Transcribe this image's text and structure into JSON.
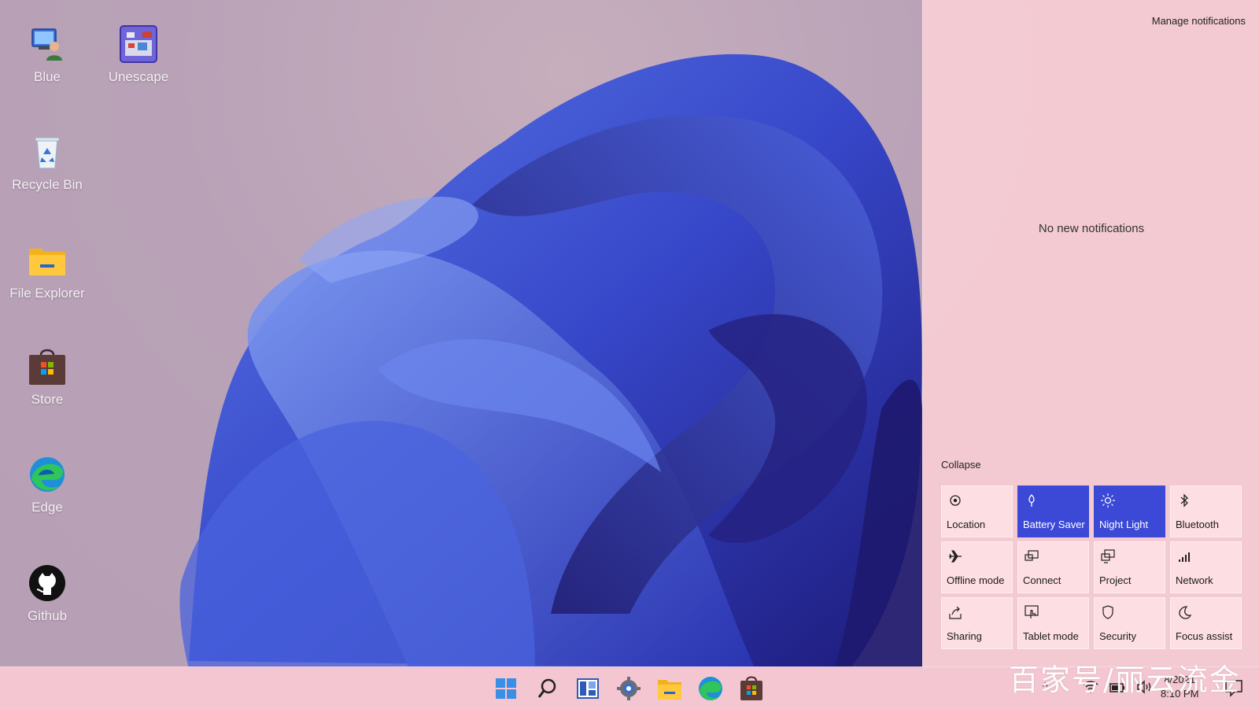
{
  "desktop": {
    "icons": [
      {
        "label": "Blue",
        "icon": "user-computer-icon"
      },
      {
        "label": "Unescape",
        "icon": "unescape-game-icon"
      },
      {
        "label": "Recycle Bin",
        "icon": "recycle-bin-icon"
      },
      {
        "label": "File Explorer",
        "icon": "folder-icon"
      },
      {
        "label": "Store",
        "icon": "store-icon"
      },
      {
        "label": "Edge",
        "icon": "edge-icon"
      },
      {
        "label": "Github",
        "icon": "github-icon"
      }
    ]
  },
  "action_center": {
    "manage_label": "Manage notifications",
    "empty_label": "No new notifications",
    "collapse_label": "Collapse",
    "tiles": [
      {
        "label": "Location",
        "icon": "location-icon",
        "active": false
      },
      {
        "label": "Battery Saver",
        "icon": "battery-saver-icon",
        "active": true
      },
      {
        "label": "Night Light",
        "icon": "night-light-icon",
        "active": true
      },
      {
        "label": "Bluetooth",
        "icon": "bluetooth-icon",
        "active": false
      },
      {
        "label": "Offline mode",
        "icon": "airplane-icon",
        "active": false
      },
      {
        "label": "Connect",
        "icon": "connect-icon",
        "active": false
      },
      {
        "label": "Project",
        "icon": "project-icon",
        "active": false
      },
      {
        "label": "Network",
        "icon": "network-icon",
        "active": false
      },
      {
        "label": "Sharing",
        "icon": "sharing-icon",
        "active": false
      },
      {
        "label": "Tablet mode",
        "icon": "tablet-mode-icon",
        "active": false
      },
      {
        "label": "Security",
        "icon": "shield-icon",
        "active": false
      },
      {
        "label": "Focus assist",
        "icon": "moon-icon",
        "active": false
      }
    ],
    "active_color": "#3b49d6"
  },
  "taskbar": {
    "apps": [
      "start-icon",
      "search-icon",
      "widgets-icon",
      "settings-icon",
      "file-explorer-icon",
      "edge-icon",
      "store-icon"
    ],
    "clock": {
      "date": "8/2021",
      "time": "8:10 PM"
    },
    "tray_chevron": "^"
  },
  "watermark": "百家号/丽云流金"
}
